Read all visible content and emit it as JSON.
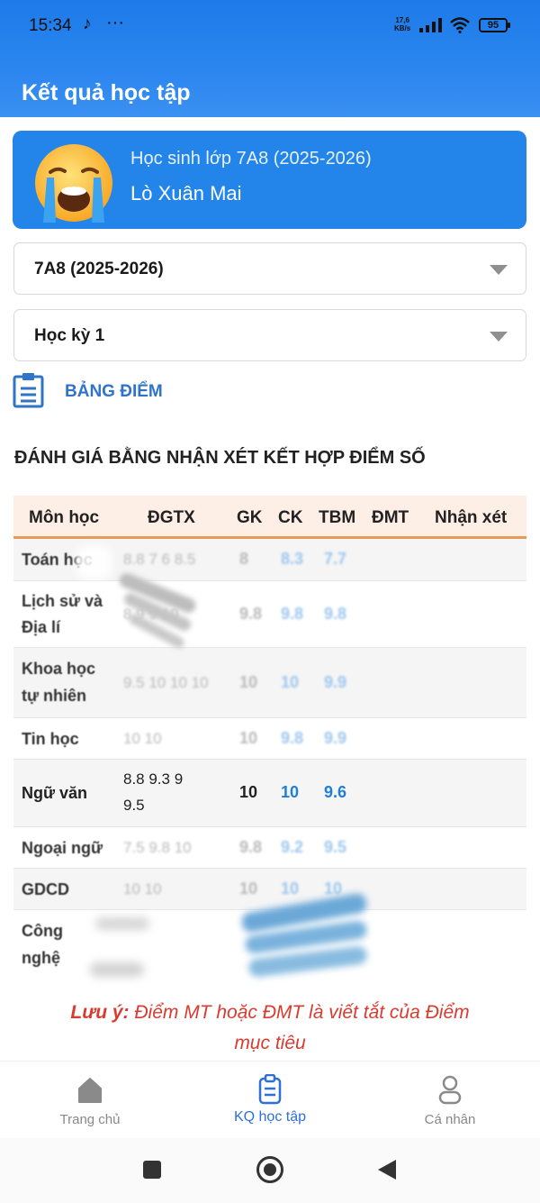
{
  "status_bar": {
    "time": "15:34",
    "network_speed": "17,6",
    "network_unit": "KB/s",
    "battery": "95"
  },
  "header": {
    "title": "Kết quả học tập"
  },
  "student": {
    "class_label": "Học sinh lớp 7A8 (2025-2026)",
    "name": "Lò Xuân Mai",
    "avatar_icon": "crying-face-emoji"
  },
  "filters": {
    "class_select": "7A8 (2025-2026)",
    "term_select": "Học kỳ 1"
  },
  "section": {
    "title": "BẢNG ĐIỂM",
    "subtitle": "ĐÁNH GIÁ BẰNG NHẬN XÉT KẾT HỢP ĐIỂM SỐ"
  },
  "table": {
    "headers": [
      "Môn học",
      "ĐGTX",
      "GK",
      "CK",
      "TBM",
      "ĐMT",
      "Nhận xét"
    ],
    "rows": [
      {
        "subject": "Toán học",
        "dgtx": "8.8 7 6 8.5",
        "gk": "8",
        "ck": "8.3",
        "tbm": "7.7"
      },
      {
        "subject_line1": "Lịch sử và",
        "subject_line2": "Địa lí",
        "dgtx": "8 9 9 10",
        "gk": "9.8",
        "ck": "9.8",
        "tbm": "9.8"
      },
      {
        "subject_line1": "Khoa học",
        "subject_line2": "tự nhiên",
        "dgtx": "9.5 10 10 10",
        "gk": "10",
        "ck": "10",
        "tbm": "9.9"
      },
      {
        "subject": "Tin học",
        "dgtx": "10 10",
        "gk": "10",
        "ck": "9.8",
        "tbm": "9.9"
      },
      {
        "subject": "Ngữ văn",
        "dgtx_line1": "8.8 9.3 9",
        "dgtx_line2": "9.5",
        "gk": "10",
        "ck": "10",
        "tbm": "9.6"
      },
      {
        "subject": "Ngoại ngữ",
        "dgtx": "7.5 9.8 10",
        "gk": "9.8",
        "ck": "9.2",
        "tbm": "9.5"
      },
      {
        "subject": "GDCD",
        "dgtx": "10 10",
        "gk": "10",
        "ck": "10",
        "tbm": "10"
      },
      {
        "subject_line1": "Công",
        "subject_line2": "nghệ"
      }
    ]
  },
  "note": {
    "prefix": "Lưu ý:",
    "text": " Điểm MT hoặc ĐMT là viết tắt của Điểm",
    "text2": "mục tiêu"
  },
  "bottom_nav": {
    "home": "Trang chủ",
    "results": "KQ học tập",
    "profile": "Cá nhân"
  },
  "colors": {
    "primary": "#2384ea",
    "accent_text": "#2f74c7",
    "note_red": "#d93b2f",
    "table_header_bg": "#fdeee6",
    "table_header_border": "#e79a55"
  }
}
